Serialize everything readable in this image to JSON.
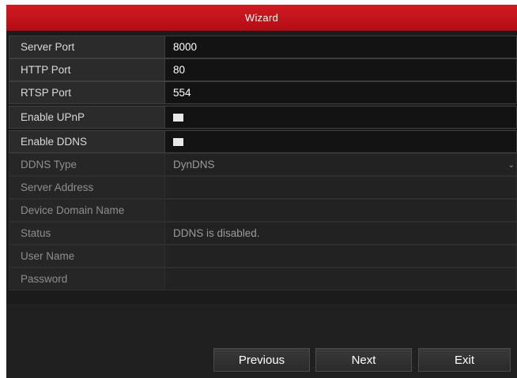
{
  "window": {
    "title": "Wizard"
  },
  "fields": {
    "server_port": {
      "label": "Server Port",
      "value": "8000"
    },
    "http_port": {
      "label": "HTTP Port",
      "value": "80"
    },
    "rtsp_port": {
      "label": "RTSP Port",
      "value": "554"
    },
    "enable_upnp": {
      "label": "Enable UPnP",
      "checked": false
    },
    "enable_ddns": {
      "label": "Enable DDNS",
      "checked": false
    },
    "ddns_type": {
      "label": "DDNS Type",
      "value": "DynDNS"
    },
    "server_address": {
      "label": "Server Address",
      "value": ""
    },
    "device_domain_name": {
      "label": "Device Domain Name",
      "value": ""
    },
    "status": {
      "label": "Status",
      "value": "DDNS is disabled."
    },
    "user_name": {
      "label": "User Name",
      "value": ""
    },
    "password": {
      "label": "Password",
      "value": ""
    }
  },
  "buttons": {
    "previous": "Previous",
    "next": "Next",
    "exit": "Exit"
  },
  "icons": {
    "dropdown": "chevron-down-icon"
  },
  "colors": {
    "title_bar": "#c8141c",
    "background": "#1b1b1b"
  }
}
